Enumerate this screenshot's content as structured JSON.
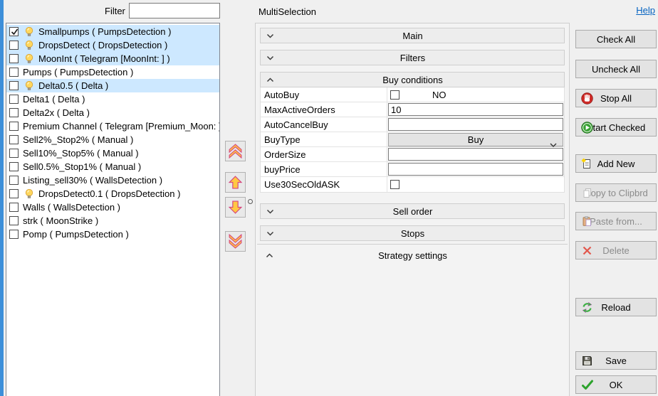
{
  "header": {
    "title": "MultiSelection",
    "help_label": "Help"
  },
  "filter": {
    "label": "Filter",
    "value": ""
  },
  "strategy_list": {
    "items": [
      {
        "label": "Smallpumps  ( PumpsDetection )",
        "checked": true,
        "bulb": true,
        "highlighted": true
      },
      {
        "label": "DropsDetect  ( DropsDetection )",
        "checked": false,
        "bulb": true,
        "highlighted": true
      },
      {
        "label": "MoonInt  ( Telegram [MoonInt: ] )",
        "checked": false,
        "bulb": true,
        "highlighted": true
      },
      {
        "label": "Pumps  ( PumpsDetection )",
        "checked": false,
        "bulb": false,
        "highlighted": false
      },
      {
        "label": "Delta0.5  ( Delta )",
        "checked": false,
        "bulb": true,
        "highlighted": true
      },
      {
        "label": "Delta1  ( Delta )",
        "checked": false,
        "bulb": false,
        "highlighted": false
      },
      {
        "label": "Delta2x  ( Delta )",
        "checked": false,
        "bulb": false,
        "highlighted": false
      },
      {
        "label": "Premium Channel  ( Telegram [Premium_Moon: ] )",
        "checked": false,
        "bulb": false,
        "highlighted": false
      },
      {
        "label": "Sell2%_Stop2%  ( Manual )",
        "checked": false,
        "bulb": false,
        "highlighted": false
      },
      {
        "label": "Sell10%_Stop5%  ( Manual )",
        "checked": false,
        "bulb": false,
        "highlighted": false
      },
      {
        "label": "Sell0.5%_Stop1%  ( Manual )",
        "checked": false,
        "bulb": false,
        "highlighted": false
      },
      {
        "label": "Listing_sell30%  ( WallsDetection )",
        "checked": false,
        "bulb": false,
        "highlighted": false
      },
      {
        "label": "DropsDetect0.1  ( DropsDetection )",
        "checked": false,
        "bulb": true,
        "highlighted": false
      },
      {
        "label": "Walls  ( WallsDetection )",
        "checked": false,
        "bulb": false,
        "highlighted": false
      },
      {
        "label": "strk  ( MoonStrike )",
        "checked": false,
        "bulb": false,
        "highlighted": false
      },
      {
        "label": "Pomp  ( PumpsDetection )",
        "checked": false,
        "bulb": false,
        "highlighted": false
      }
    ]
  },
  "reorder": {
    "icons": [
      "move-top-double-up-arrow",
      "move-up-arrow",
      "move-down-arrow",
      "move-bottom-double-down-arrow"
    ]
  },
  "sections": {
    "main": "Main",
    "filters": "Filters",
    "buy": "Buy conditions",
    "sell": "Sell order",
    "stops": "Stops",
    "strategy": "Strategy settings"
  },
  "buy_fields": {
    "autobuy": {
      "label": "AutoBuy",
      "checked": false,
      "value_text": "NO"
    },
    "max_active_orders": {
      "label": "MaxActiveOrders",
      "value": "10"
    },
    "auto_cancel_buy": {
      "label": "AutoCancelBuy",
      "value": ""
    },
    "buy_type": {
      "label": "BuyType",
      "value": "Buy"
    },
    "order_size": {
      "label": "OrderSize",
      "value": ""
    },
    "buy_price": {
      "label": "buyPrice",
      "value": ""
    },
    "use30sec": {
      "label": "Use30SecOldASK",
      "checked": false
    }
  },
  "actions": {
    "check_all": {
      "label": "Check All",
      "enabled": true,
      "icon": ""
    },
    "uncheck_all": {
      "label": "Uncheck All",
      "enabled": true,
      "icon": ""
    },
    "stop_all": {
      "label": "Stop All",
      "enabled": true,
      "icon": "stop-hand-icon"
    },
    "start_checked": {
      "label": "Start Checked",
      "enabled": true,
      "icon": "start-play-icon"
    },
    "add_new": {
      "label": "Add New",
      "enabled": true,
      "icon": "new-document-icon"
    },
    "copy": {
      "label": "Copy to Clipbrd",
      "enabled": false,
      "icon": "copy-pages-icon"
    },
    "paste": {
      "label": "Paste from...",
      "enabled": false,
      "icon": "paste-clipboard-icon"
    },
    "delete": {
      "label": "Delete",
      "enabled": false,
      "icon": "red-x-icon"
    },
    "reload": {
      "label": "Reload",
      "enabled": true,
      "icon": "reload-arrows-icon"
    },
    "save": {
      "label": "Save",
      "enabled": true,
      "icon": "floppy-disk-icon"
    },
    "ok": {
      "label": "OK",
      "enabled": true,
      "icon": "green-check-icon"
    }
  },
  "colors": {
    "accent_strip": "#3d8fd9",
    "list_highlight": "#cde8ff",
    "help_link": "#0563c1",
    "arrow_fill": "#ffc842",
    "arrow_stroke": "#d6447e"
  }
}
